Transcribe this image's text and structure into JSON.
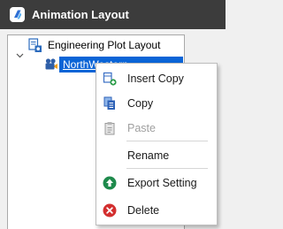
{
  "window": {
    "title": "Animation Layout"
  },
  "tree": {
    "root": {
      "label": "Engineering Plot Layout",
      "expanded": true
    },
    "child": {
      "label": "NorthWestern",
      "selected": true
    }
  },
  "context_menu": {
    "items": [
      {
        "id": "insert-copy",
        "label": "Insert Copy",
        "icon": "insert-copy-icon",
        "enabled": true
      },
      {
        "id": "copy",
        "label": "Copy",
        "icon": "copy-icon",
        "enabled": true
      },
      {
        "id": "paste",
        "label": "Paste",
        "icon": "paste-icon",
        "enabled": false
      },
      {
        "id": "rename",
        "label": "Rename",
        "icon": "",
        "enabled": true
      },
      {
        "id": "export-setting",
        "label": "Export Setting",
        "icon": "export-icon",
        "enabled": true
      },
      {
        "id": "delete",
        "label": "Delete",
        "icon": "delete-icon",
        "enabled": true
      }
    ]
  },
  "colors": {
    "titlebar": "#3c3c3c",
    "selection": "#0a64d6",
    "export_green": "#1e8a4c",
    "delete_red": "#d32f2f"
  }
}
